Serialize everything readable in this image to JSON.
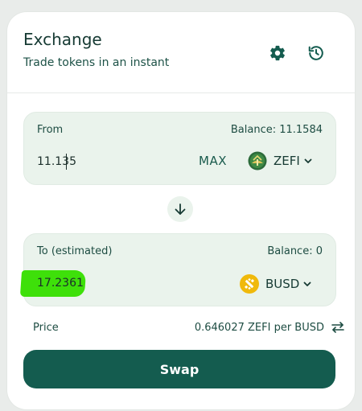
{
  "header": {
    "title": "Exchange",
    "subtitle": "Trade tokens in an instant",
    "settings_icon": "gear-icon",
    "history_icon": "history-icon"
  },
  "from": {
    "label": "From",
    "balance": "Balance: 11.1584",
    "amount": "11.135",
    "max_label": "MAX",
    "token": "ZEFI",
    "token_icon": "zefi-token-icon"
  },
  "direction_icon": "arrow-down-icon",
  "to": {
    "label": "To (estimated)",
    "balance": "Balance: 0",
    "amount": "17.2361",
    "token": "BUSD",
    "token_icon": "busd-token-icon",
    "highlight_color": "#3ee00a"
  },
  "price": {
    "label": "Price",
    "value": "0.646027 ZEFI per BUSD",
    "toggle_icon": "swap-horizontal-icon"
  },
  "actions": {
    "swap_label": "Swap"
  },
  "colors": {
    "accent": "#145c4f",
    "panel_bg": "#eaf3ec"
  }
}
